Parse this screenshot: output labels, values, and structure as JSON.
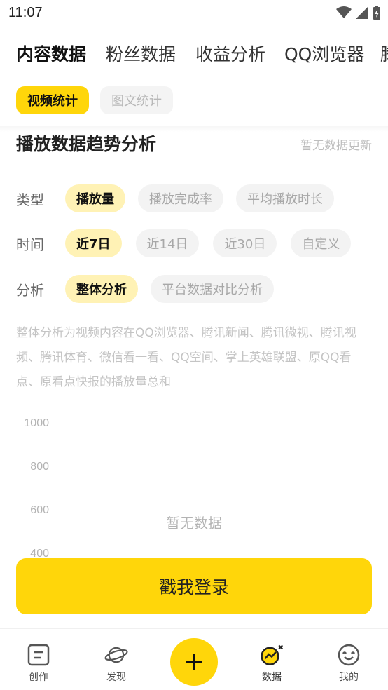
{
  "status_bar": {
    "time": "11:07"
  },
  "top_tabs": [
    {
      "label": "内容数据",
      "active": true
    },
    {
      "label": "粉丝数据",
      "active": false
    },
    {
      "label": "收益分析",
      "active": false
    },
    {
      "label": "QQ浏览器",
      "active": false
    },
    {
      "label": "腾",
      "active": false
    }
  ],
  "sub_tabs": [
    {
      "label": "视频统计",
      "active": true
    },
    {
      "label": "图文统计",
      "active": false
    }
  ],
  "section": {
    "title": "播放数据趋势分析",
    "note": "暂无数据更新"
  },
  "filters": {
    "type": {
      "label": "类型",
      "options": [
        "播放量",
        "播放完成率",
        "平均播放时长"
      ],
      "selected": "播放量"
    },
    "time": {
      "label": "时间",
      "options": [
        "近7日",
        "近14日",
        "近30日",
        "自定义"
      ],
      "selected": "近7日"
    },
    "analysis": {
      "label": "分析",
      "options": [
        "整体分析",
        "平台数据对比分析"
      ],
      "selected": "整体分析"
    }
  },
  "description": "整体分析为视频内容在QQ浏览器、腾讯新闻、腾讯微视、腾讯视频、腾讯体育、微信看一看、QQ空间、掌上英雄联盟、原QQ看点、原看点快报的播放量总和",
  "chart_data": {
    "type": "line",
    "y_ticks": [
      "1000",
      "800",
      "600",
      "400"
    ],
    "empty_message": "暂无数据",
    "series": []
  },
  "login_button": "戳我登录",
  "bottom_nav": [
    {
      "label": "创作",
      "icon": "document-icon"
    },
    {
      "label": "发现",
      "icon": "planet-icon"
    },
    {
      "label": "",
      "icon": "plus-icon"
    },
    {
      "label": "数据",
      "icon": "data-chart-icon"
    },
    {
      "label": "我的",
      "icon": "face-icon"
    }
  ],
  "colors": {
    "accent": "#FFD60A",
    "accent_light": "#FFF2B5"
  }
}
